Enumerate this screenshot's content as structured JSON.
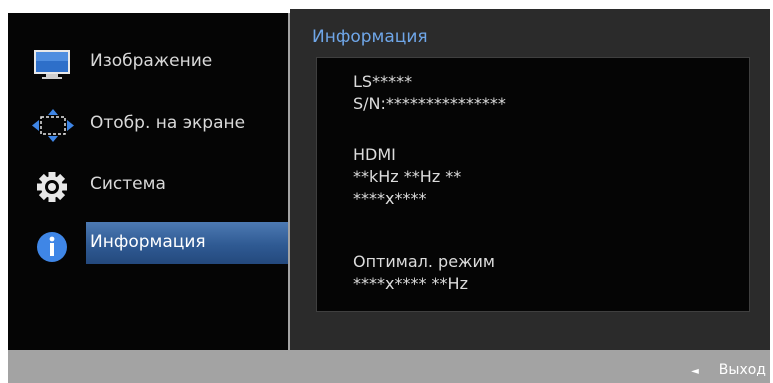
{
  "menu": {
    "items": [
      {
        "label": "Изображение",
        "icon": "monitor-icon"
      },
      {
        "label": "Отобр. на экране",
        "icon": "screen-arrows-icon"
      },
      {
        "label": "Система",
        "icon": "gear-icon"
      },
      {
        "label": "Информация",
        "icon": "info-icon",
        "active": true
      }
    ]
  },
  "info": {
    "title": "Информация",
    "lines": [
      "LS*****",
      "S/N:***************",
      "HDMI",
      "**kHz **Hz **",
      "****x****",
      "Оптимал. режим",
      "****x**** **Hz"
    ]
  },
  "footer": {
    "arrow": "◄",
    "exit_label": "Выход"
  },
  "colors": {
    "accent": "#6fa6e8",
    "highlight": "#3b67a3",
    "panel": "#2b2b2b",
    "frame": "#a3a3a3"
  }
}
